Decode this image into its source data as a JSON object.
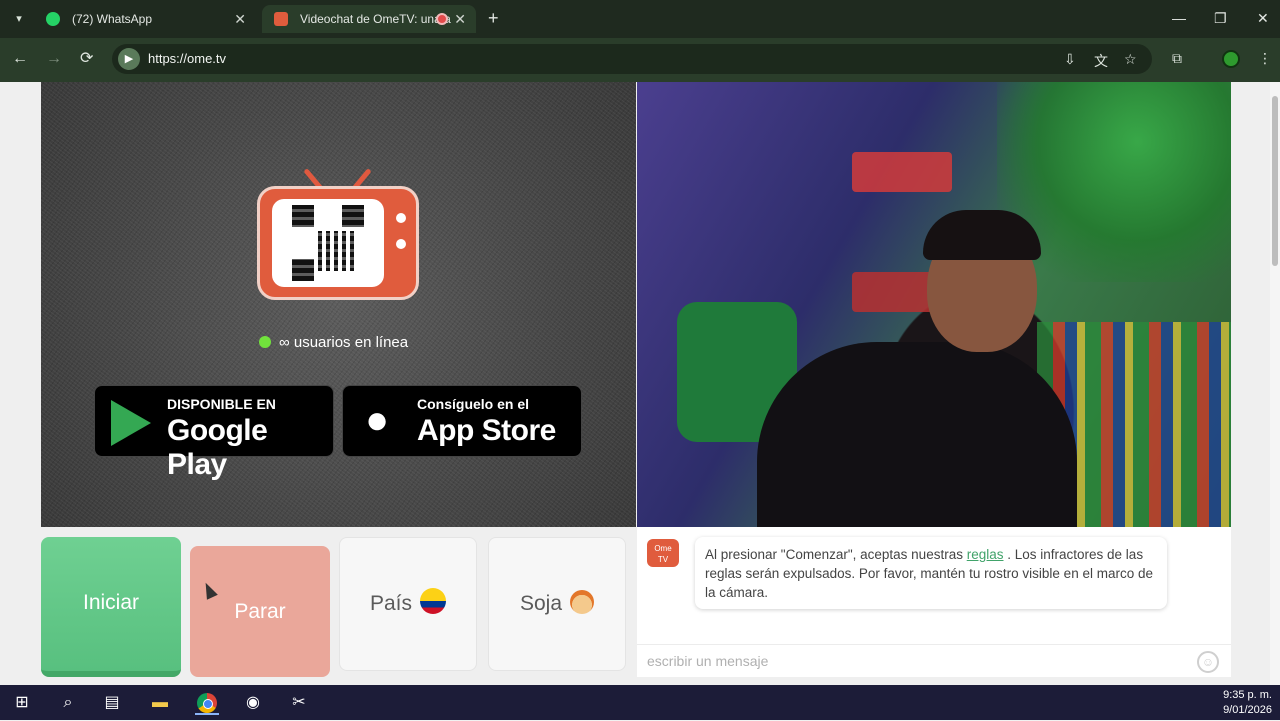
{
  "browser": {
    "tabs": [
      {
        "title": "(72) WhatsApp",
        "icon": "whatsapp-icon",
        "close": "✕"
      },
      {
        "title": "Videochat de OmeTV: una a",
        "icon": "ometv-icon",
        "close": "✕"
      }
    ],
    "new_tab": "+",
    "window": {
      "minimize": "—",
      "maximize": "❐",
      "close": "✕"
    },
    "nav": {
      "back": "←",
      "forward": "→",
      "reload": "⟳"
    },
    "url": "https://ome.tv",
    "toolbar_icons": [
      "install-icon",
      "translate-icon",
      "star-icon",
      "extensions-icon",
      "profile-icon"
    ]
  },
  "page": {
    "online_text": "∞ usuarios en línea",
    "google_play": {
      "small": "DISPONIBLE EN",
      "big": "Google Play"
    },
    "app_store": {
      "small": "Consíguelo en el",
      "big": "App Store"
    },
    "controls": {
      "start": "Iniciar",
      "stop": "Parar",
      "country": "País",
      "gender": "Soja"
    },
    "chat": {
      "logo_line1": "Ome",
      "logo_line2": "TV",
      "message_before": "Al presionar \"Comenzar\", aceptas nuestras ",
      "rules_link": "reglas",
      "message_after": " . Los infractores de las reglas serán expulsados. Por favor, mantén tu rostro visible en el marco de la cámara.",
      "input_placeholder": "escribir un mensaje"
    }
  },
  "taskbar": {
    "time": "9:35 p. m.",
    "date": "9/01/2026"
  },
  "colors": {
    "start_green": "#5fc585",
    "stop_salmon": "#eaa79a",
    "ome_orange": "#e05c3d",
    "online_green": "#71e23c",
    "rules_link": "#41a36a"
  }
}
